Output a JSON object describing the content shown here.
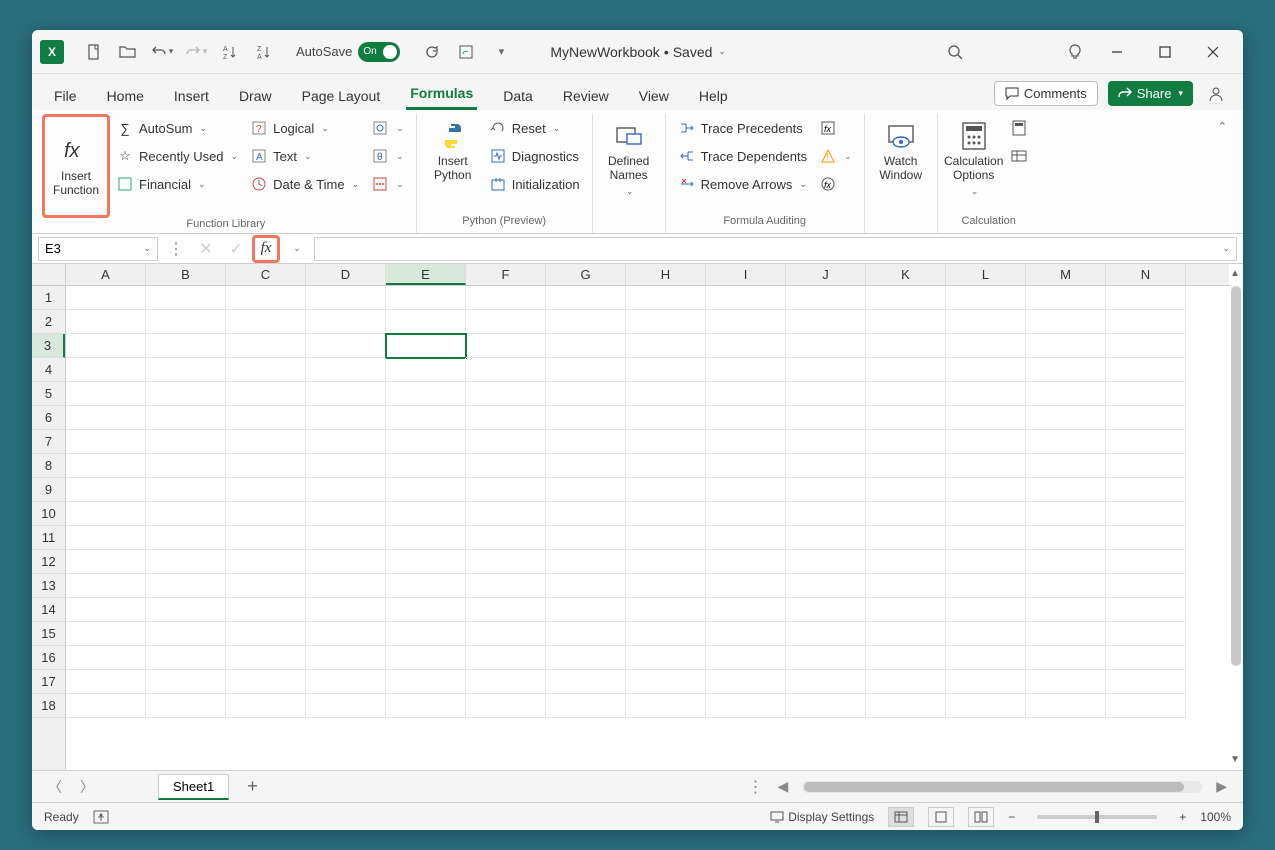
{
  "titlebar": {
    "autosave_label": "AutoSave",
    "autosave_state": "On",
    "doc_name": "MyNewWorkbook",
    "doc_status": "Saved"
  },
  "tabs": {
    "items": [
      "File",
      "Home",
      "Insert",
      "Draw",
      "Page Layout",
      "Formulas",
      "Data",
      "Review",
      "View",
      "Help"
    ],
    "active": "Formulas",
    "comments": "Comments",
    "share": "Share"
  },
  "ribbon": {
    "insert_function": "Insert Function",
    "fn_lib": {
      "autosum": "AutoSum",
      "recent": "Recently Used",
      "financial": "Financial",
      "logical": "Logical",
      "text": "Text",
      "datetime": "Date & Time",
      "label": "Function Library"
    },
    "python": {
      "insert": "Insert Python",
      "reset": "Reset",
      "diagnostics": "Diagnostics",
      "init": "Initialization",
      "label": "Python (Preview)"
    },
    "names": {
      "defined": "Defined Names",
      "label": ""
    },
    "auditing": {
      "precedents": "Trace Precedents",
      "dependents": "Trace Dependents",
      "remove": "Remove Arrows",
      "label": "Formula Auditing"
    },
    "watch": "Watch Window",
    "calc": {
      "options": "Calculation Options",
      "label": "Calculation"
    }
  },
  "formula_bar": {
    "name_box": "E3",
    "formula": ""
  },
  "grid": {
    "columns": [
      "A",
      "B",
      "C",
      "D",
      "E",
      "F",
      "G",
      "H",
      "I",
      "J",
      "K",
      "L",
      "M",
      "N"
    ],
    "rows": [
      1,
      2,
      3,
      4,
      5,
      6,
      7,
      8,
      9,
      10,
      11,
      12,
      13,
      14,
      15,
      16,
      17,
      18
    ],
    "active_col": "E",
    "active_row": 3
  },
  "sheetbar": {
    "sheet": "Sheet1"
  },
  "statusbar": {
    "ready": "Ready",
    "display_settings": "Display Settings",
    "zoom": "100%"
  }
}
